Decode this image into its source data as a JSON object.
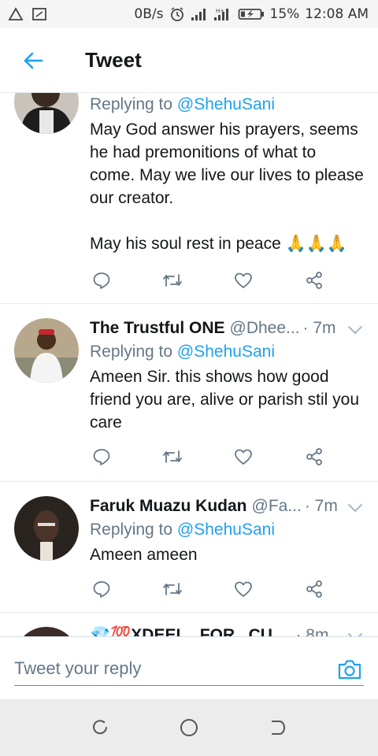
{
  "status_bar": {
    "network_speed": "0B/s",
    "battery": "15%",
    "time": "12:08 AM"
  },
  "header": {
    "title": "Tweet"
  },
  "colors": {
    "accent": "#1da1f2",
    "secondary_text": "#657786",
    "primary_text": "#14171a"
  },
  "tweets": [
    {
      "name": "",
      "handle": "",
      "time": "",
      "replying_prefix": "Replying to",
      "replying_to": "@ShehuSani",
      "text": "May God answer his prayers, seems he had premonitions of what to come. May we live our lives to please our creator.\n\nMay his soul rest in peace 🙏🙏🙏"
    },
    {
      "name": "The Trustful ONE",
      "handle": "@Dhee...",
      "time": "· 7m",
      "replying_prefix": "Replying to",
      "replying_to": "@ShehuSani",
      "text": "Ameen Sir.  this shows how good friend you are,  alive or parish stil you care"
    },
    {
      "name": "Faruk Muazu Kudan",
      "handle": "@Fa...",
      "time": "· 7m",
      "replying_prefix": "Replying to",
      "replying_to": "@ShehuSani",
      "text": "Ameen ameen"
    },
    {
      "name": "💎💯XDEEL...FOR...CU...",
      "handle": "",
      "time": "· 8m",
      "replying_prefix": "",
      "replying_to": "",
      "text": ""
    }
  ],
  "reply_bar": {
    "placeholder": "Tweet your reply"
  },
  "icons": {
    "back": "arrow-left-icon",
    "reply": "comment-icon",
    "retweet": "retweet-icon",
    "like": "heart-icon",
    "share": "share-icon",
    "caret": "chevron-down-icon",
    "camera": "camera-icon"
  }
}
